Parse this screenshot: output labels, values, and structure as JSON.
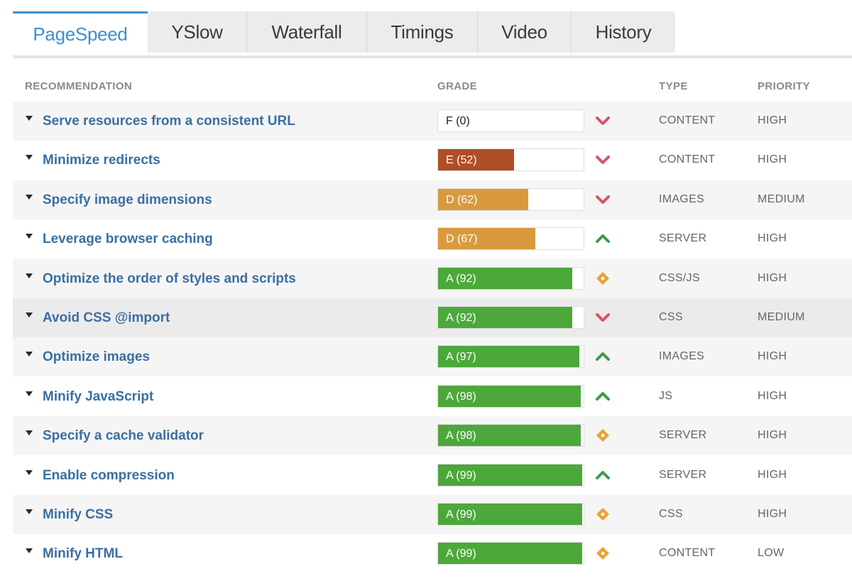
{
  "tabs": [
    {
      "label": "PageSpeed",
      "active": true
    },
    {
      "label": "YSlow",
      "active": false
    },
    {
      "label": "Waterfall",
      "active": false
    },
    {
      "label": "Timings",
      "active": false
    },
    {
      "label": "Video",
      "active": false
    },
    {
      "label": "History",
      "active": false
    }
  ],
  "table": {
    "headers": {
      "recommendation": "RECOMMENDATION",
      "grade": "GRADE",
      "type": "TYPE",
      "priority": "PRIORITY"
    },
    "rows": [
      {
        "title": "Serve resources from a consistent URL",
        "grade": "F (0)",
        "score": 0,
        "trend": "down",
        "type": "CONTENT",
        "priority": "HIGH"
      },
      {
        "title": "Minimize redirects",
        "grade": "E (52)",
        "score": 52,
        "trend": "down",
        "type": "CONTENT",
        "priority": "HIGH"
      },
      {
        "title": "Specify image dimensions",
        "grade": "D (62)",
        "score": 62,
        "trend": "down",
        "type": "IMAGES",
        "priority": "MEDIUM"
      },
      {
        "title": "Leverage browser caching",
        "grade": "D (67)",
        "score": 67,
        "trend": "up",
        "type": "SERVER",
        "priority": "HIGH"
      },
      {
        "title": "Optimize the order of styles and scripts",
        "grade": "A (92)",
        "score": 92,
        "trend": "neutral",
        "type": "CSS/JS",
        "priority": "HIGH"
      },
      {
        "title": "Avoid CSS @import",
        "grade": "A (92)",
        "score": 92,
        "trend": "down",
        "type": "CSS",
        "priority": "MEDIUM"
      },
      {
        "title": "Optimize images",
        "grade": "A (97)",
        "score": 97,
        "trend": "up",
        "type": "IMAGES",
        "priority": "HIGH"
      },
      {
        "title": "Minify JavaScript",
        "grade": "A (98)",
        "score": 98,
        "trend": "up",
        "type": "JS",
        "priority": "HIGH"
      },
      {
        "title": "Specify a cache validator",
        "grade": "A (98)",
        "score": 98,
        "trend": "neutral",
        "type": "SERVER",
        "priority": "HIGH"
      },
      {
        "title": "Enable compression",
        "grade": "A (99)",
        "score": 99,
        "trend": "up",
        "type": "SERVER",
        "priority": "HIGH"
      },
      {
        "title": "Minify CSS",
        "grade": "A (99)",
        "score": 99,
        "trend": "neutral",
        "type": "CSS",
        "priority": "HIGH"
      },
      {
        "title": "Minify HTML",
        "grade": "A (99)",
        "score": 99,
        "trend": "neutral",
        "type": "CONTENT",
        "priority": "LOW"
      }
    ]
  },
  "colors": {
    "accent": "#3f8fcf",
    "grade_A": "#4ca83a",
    "grade_D": "#d99a3e",
    "grade_E": "#b04e25",
    "trend_down": "#d9536a",
    "trend_up": "#3e9a48",
    "trend_neutral": "#e8a23a"
  },
  "icons": {
    "expand": "caret-down-icon",
    "down": "chevron-down-icon",
    "up": "chevron-up-icon",
    "neutral": "diamond-icon"
  }
}
